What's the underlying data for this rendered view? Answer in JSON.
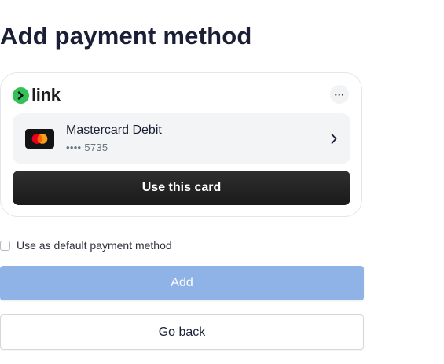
{
  "page": {
    "title": "Add payment method"
  },
  "link": {
    "brand_text": "link",
    "logo_icon": "link-arrow-icon",
    "more_label": "···",
    "accent_color": "#33c15a",
    "card": {
      "brand_icon": "mastercard-icon",
      "name": "Mastercard Debit",
      "number": "•••• 5735"
    },
    "use_card_label": "Use this card"
  },
  "form": {
    "default_checkbox_label": "Use as default payment method",
    "default_checked": false,
    "add_label": "Add",
    "add_color": "#8fb3e6",
    "back_label": "Go back"
  }
}
